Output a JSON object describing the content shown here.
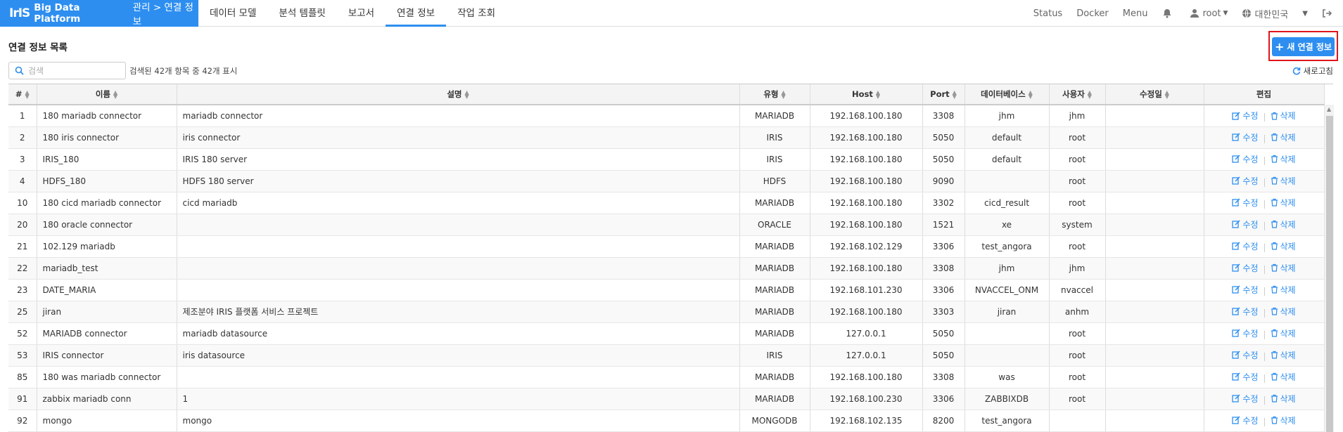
{
  "brand": {
    "logo": "IrIS",
    "platform": "Big Data Platform",
    "breadcrumb": "관리 > 연결 정보",
    "color": "#2d8ef0"
  },
  "nav": [
    "데이터 모델",
    "분석 템플릿",
    "보고서",
    "연결 정보",
    "작업 조회"
  ],
  "nav_active": "연결 정보",
  "right_menu": {
    "status": "Status",
    "docker": "Docker",
    "menu": "Menu",
    "user": "root",
    "locale": "대한민국"
  },
  "page": {
    "title": "연결 정보 목록",
    "new_button": "새 연결 정보",
    "search_placeholder": "검색",
    "result_text": "검색된 42개 항목 중 42개 표시",
    "refresh": "새로고침"
  },
  "table": {
    "headers": [
      "#",
      "이름",
      "설명",
      "유형",
      "Host",
      "Port",
      "데이터베이스",
      "사용자",
      "수정일",
      "편집"
    ],
    "edit_label": "수정",
    "delete_label": "삭제",
    "rows": [
      [
        "1",
        "180 mariadb connector",
        "mariadb connector",
        "MARIADB",
        "192.168.100.180",
        "3308",
        "jhm",
        "jhm",
        ""
      ],
      [
        "2",
        "180 iris connector",
        "iris connector",
        "IRIS",
        "192.168.100.180",
        "5050",
        "default",
        "root",
        ""
      ],
      [
        "3",
        "IRIS_180",
        "IRIS 180 server",
        "IRIS",
        "192.168.100.180",
        "5050",
        "default",
        "root",
        ""
      ],
      [
        "4",
        "HDFS_180",
        "HDFS 180 server",
        "HDFS",
        "192.168.100.180",
        "9090",
        "",
        "root",
        ""
      ],
      [
        "10",
        "180 cicd mariadb connector",
        "cicd mariadb",
        "MARIADB",
        "192.168.100.180",
        "3302",
        "cicd_result",
        "root",
        ""
      ],
      [
        "20",
        "180 oracle connector",
        "",
        "ORACLE",
        "192.168.100.180",
        "1521",
        "xe",
        "system",
        ""
      ],
      [
        "21",
        "102.129 mariadb",
        "",
        "MARIADB",
        "192.168.102.129",
        "3306",
        "test_angora",
        "root",
        ""
      ],
      [
        "22",
        "mariadb_test",
        "",
        "MARIADB",
        "192.168.100.180",
        "3308",
        "jhm",
        "jhm",
        ""
      ],
      [
        "23",
        "DATE_MARIA",
        "",
        "MARIADB",
        "192.168.101.230",
        "3306",
        "NVACCEL_ONM",
        "nvaccel",
        ""
      ],
      [
        "25",
        "jiran",
        "제조분야 IRIS 플랫폼 서비스 프로젝트",
        "MARIADB",
        "192.168.100.180",
        "3303",
        "jiran",
        "anhm",
        ""
      ],
      [
        "52",
        "MARIADB connector",
        "mariadb datasource",
        "MARIADB",
        "127.0.0.1",
        "5050",
        "",
        "root",
        ""
      ],
      [
        "53",
        "IRIS connector",
        "iris datasource",
        "IRIS",
        "127.0.0.1",
        "5050",
        "",
        "root",
        ""
      ],
      [
        "85",
        "180 was mariadb connector",
        "",
        "MARIADB",
        "192.168.100.180",
        "3308",
        "was",
        "root",
        ""
      ],
      [
        "91",
        "zabbix mariadb conn",
        "1",
        "MARIADB",
        "192.168.100.230",
        "3306",
        "ZABBIXDB",
        "root",
        ""
      ],
      [
        "92",
        "mongo",
        "mongo",
        "MONGODB",
        "192.168.102.135",
        "8200",
        "test_angora",
        "",
        ""
      ]
    ]
  }
}
